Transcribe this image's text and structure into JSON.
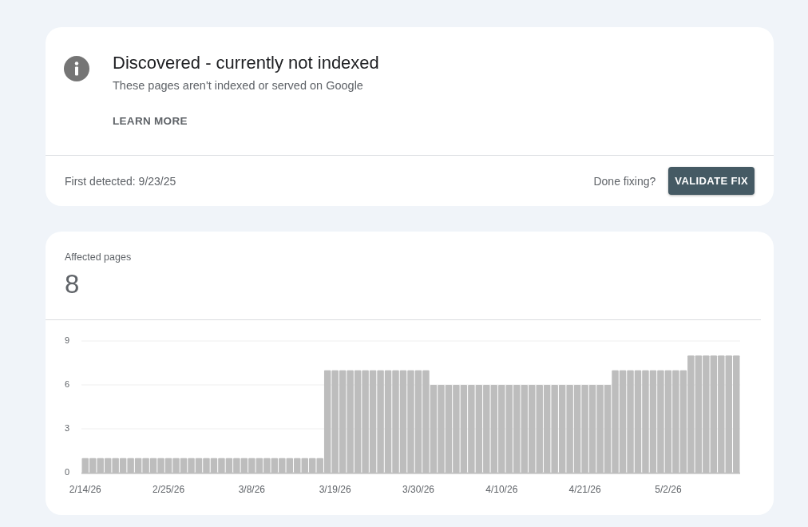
{
  "issue_card": {
    "title": "Discovered - currently not indexed",
    "description": "These pages aren't indexed or served on Google",
    "learn_more": "LEARN MORE",
    "first_detected": "First detected: 9/23/25",
    "done_fixing": "Done fixing?",
    "validate_button": "VALIDATE FIX"
  },
  "affected_card": {
    "label": "Affected pages",
    "count": "8",
    "chart_data": {
      "type": "bar",
      "categories": [
        "2/14/26",
        null,
        null,
        null,
        null,
        null,
        null,
        null,
        null,
        null,
        null,
        "2/25/26",
        null,
        null,
        null,
        null,
        null,
        null,
        null,
        null,
        null,
        null,
        "3/8/26",
        null,
        null,
        null,
        null,
        null,
        null,
        null,
        null,
        null,
        null,
        "3/19/26",
        null,
        null,
        null,
        null,
        null,
        null,
        null,
        null,
        null,
        null,
        "3/30/26",
        null,
        null,
        null,
        null,
        null,
        null,
        null,
        null,
        null,
        null,
        "4/10/26",
        null,
        null,
        null,
        null,
        null,
        null,
        null,
        null,
        null,
        null,
        "4/21/26",
        null,
        null,
        null,
        null,
        null,
        null,
        null,
        null,
        null,
        null,
        "5/2/26",
        null,
        null,
        null,
        null,
        null,
        null,
        null,
        null,
        null
      ],
      "values": [
        1,
        1,
        1,
        1,
        1,
        1,
        1,
        1,
        1,
        1,
        1,
        1,
        1,
        1,
        1,
        1,
        1,
        1,
        1,
        1,
        1,
        1,
        1,
        1,
        1,
        1,
        1,
        1,
        1,
        1,
        1,
        1,
        7,
        7,
        7,
        7,
        7,
        7,
        7,
        7,
        7,
        7,
        7,
        7,
        7,
        7,
        6,
        6,
        6,
        6,
        6,
        6,
        6,
        6,
        6,
        6,
        6,
        6,
        6,
        6,
        6,
        6,
        6,
        6,
        6,
        6,
        6,
        6,
        6,
        6,
        7,
        7,
        7,
        7,
        7,
        7,
        7,
        7,
        7,
        7,
        8,
        8,
        8,
        8,
        8,
        8,
        8
      ],
      "ylim": [
        0,
        9
      ],
      "yticks": [
        0,
        3,
        6,
        9
      ]
    }
  }
}
